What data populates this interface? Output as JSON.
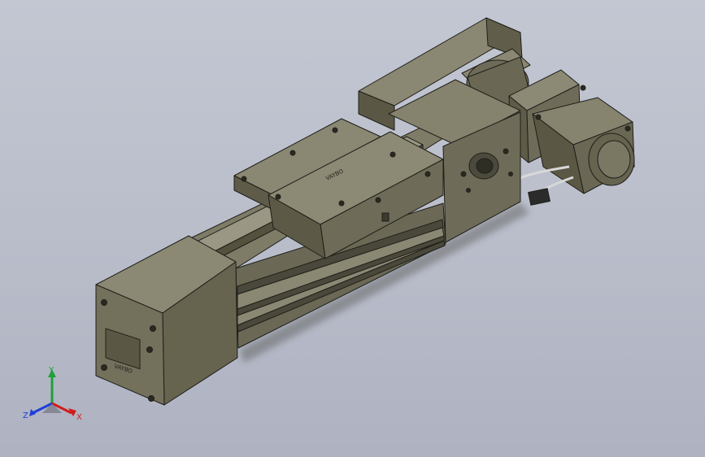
{
  "viewport": {
    "background_top": "#c3c7d2",
    "background_bottom": "#aeb2c1"
  },
  "model": {
    "body_color": "#6e6b58",
    "body_dark": "#55533f",
    "body_light": "#8a8773",
    "edge_color": "#1f1f1a",
    "brand_mark_carriage": "VAYBO",
    "brand_mark_endcap": "VAYBO"
  },
  "triad": {
    "x_label": "X",
    "y_label": "Y",
    "z_label": "Z",
    "x_color": "#d21c1c",
    "y_color": "#1ea03a",
    "z_color": "#1f3fd6"
  }
}
